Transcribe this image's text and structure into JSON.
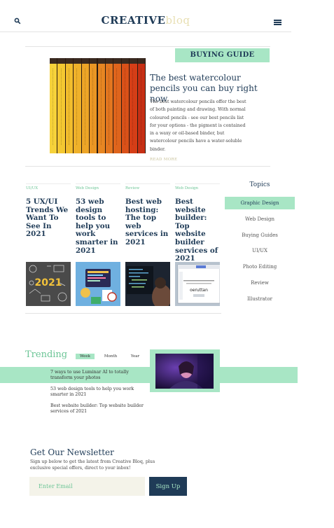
{
  "header": {
    "logo_main": "CREATIVE",
    "logo_accent": "bloq",
    "search_icon": "search-icon",
    "menu_icon": "hamburger-menu-icon"
  },
  "featured": {
    "tag": "BUYING GUIDE",
    "title": "The best watercolour pencils you can buy right now",
    "body": "The best watercolour pencils offer the best of both painting and drawing. With normal coloured pencils - see our best pencils list for your options - the pigment is contained in a waxy or oil-based binder, but watercolour pencils have a water-soluble binder.",
    "read_more": "READ MORE"
  },
  "cards": [
    {
      "category": "UI/UX",
      "title": "5 UX/UI Trends We Want To See In 2021"
    },
    {
      "category": "Web Design",
      "title": "53 web design tools to help you work smarter in 2021"
    },
    {
      "category": "Review",
      "title": "Best web hosting: The top web services in 2021"
    },
    {
      "category": "Web Design",
      "title": "Best website builder: Top website builder services of 2021"
    }
  ],
  "topics": {
    "title": "Topics",
    "items": [
      "Graphic Design",
      "Web Design",
      "Buying Guides",
      "UI/UX",
      "Photo Editing",
      "Review",
      "Illustrator"
    ],
    "active_index": 0
  },
  "trending": {
    "title": "Trending",
    "tabs": [
      "Week",
      "Month",
      "Year"
    ],
    "active_tab": 0,
    "items": [
      "7 ways to use Luminar AI to totally transform your photos",
      "53 web design tools to help you work smarter in 2021",
      "Best website builder: Top website builder services of 2021"
    ]
  },
  "newsletter": {
    "title": "Get Our Newsletter",
    "subtitle": "Sign up below to get the latest from Creative Bloq, plus exclusive special offers, direct to your inbox!",
    "placeholder": "Enter Email",
    "button": "Sign Up"
  },
  "colors": {
    "navy": "#1f3b57",
    "mint": "#a8e6c5",
    "green_text": "#6cc596",
    "cream": "#f4f3e9"
  }
}
